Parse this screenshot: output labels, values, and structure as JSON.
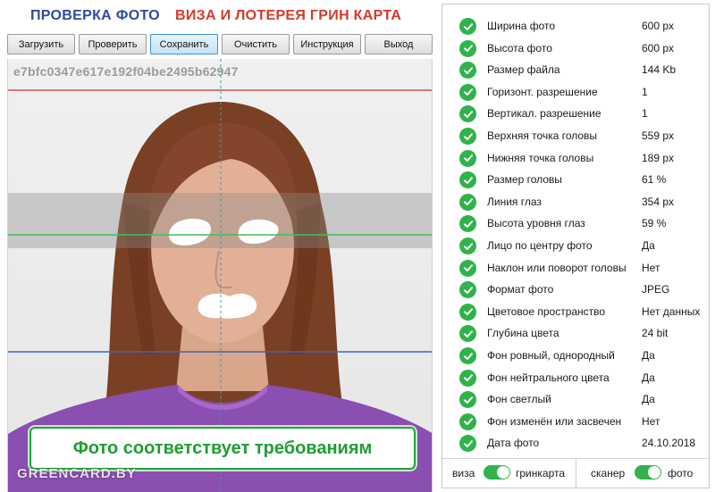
{
  "header": {
    "title_check": "ПРОВЕРКА ФОТО",
    "title_visa": "ВИЗА И ЛОТЕРЕЯ ГРИН КАРТА"
  },
  "toolbar": {
    "buttons": [
      "Загрузить",
      "Проверить",
      "Сохранить",
      "Очистить",
      "Инструкция",
      "Выход"
    ],
    "active": "Сохранить"
  },
  "photo": {
    "hash": "e7bfc0347e617e192f04be2495b62947",
    "verdict": "Фото соответствует требованиям",
    "watermark": "GREENCARD.BY",
    "colors": {
      "top_line": "#d9504a",
      "eye_line": "#3fbf5a",
      "chin_line": "#3d62c8",
      "center_line": "#3f9c9c"
    }
  },
  "checks": [
    {
      "label": "Ширина фото",
      "value": "600 px"
    },
    {
      "label": "Высота фото",
      "value": "600 px"
    },
    {
      "label": "Размер файла",
      "value": "144 Kb"
    },
    {
      "label": "Горизонт. разрешение",
      "value": "1"
    },
    {
      "label": "Вертикал. разрешение",
      "value": "1"
    },
    {
      "label": "Верхняя точка головы",
      "value": "559 px"
    },
    {
      "label": "Нижняя точка головы",
      "value": "189 px"
    },
    {
      "label": "Размер головы",
      "value": "61 %"
    },
    {
      "label": "Линия глаз",
      "value": "354 px"
    },
    {
      "label": "Высота уровня глаз",
      "value": "59 %"
    },
    {
      "label": "Лицо по центру фото",
      "value": "Да"
    },
    {
      "label": "Наклон или поворот головы",
      "value": "Нет"
    },
    {
      "label": "Формат фото",
      "value": "JPEG"
    },
    {
      "label": "Цветовое пространство",
      "value": "Нет данных"
    },
    {
      "label": "Глубина цвета",
      "value": "24 bit"
    },
    {
      "label": "Фон ровный, однородный",
      "value": "Да"
    },
    {
      "label": "Фон нейтрального цвета",
      "value": "Да"
    },
    {
      "label": "Фон светлый",
      "value": "Да"
    },
    {
      "label": "Фон изменён или засвечен",
      "value": "Нет"
    },
    {
      "label": "Дата фото",
      "value": "24.10.2018"
    }
  ],
  "toggles": {
    "left": {
      "off_label": "виза",
      "on_label": "гринкарта",
      "state": "on"
    },
    "right": {
      "off_label": "сканер",
      "on_label": "фото",
      "state": "on"
    }
  },
  "accent": "#2fb34a"
}
